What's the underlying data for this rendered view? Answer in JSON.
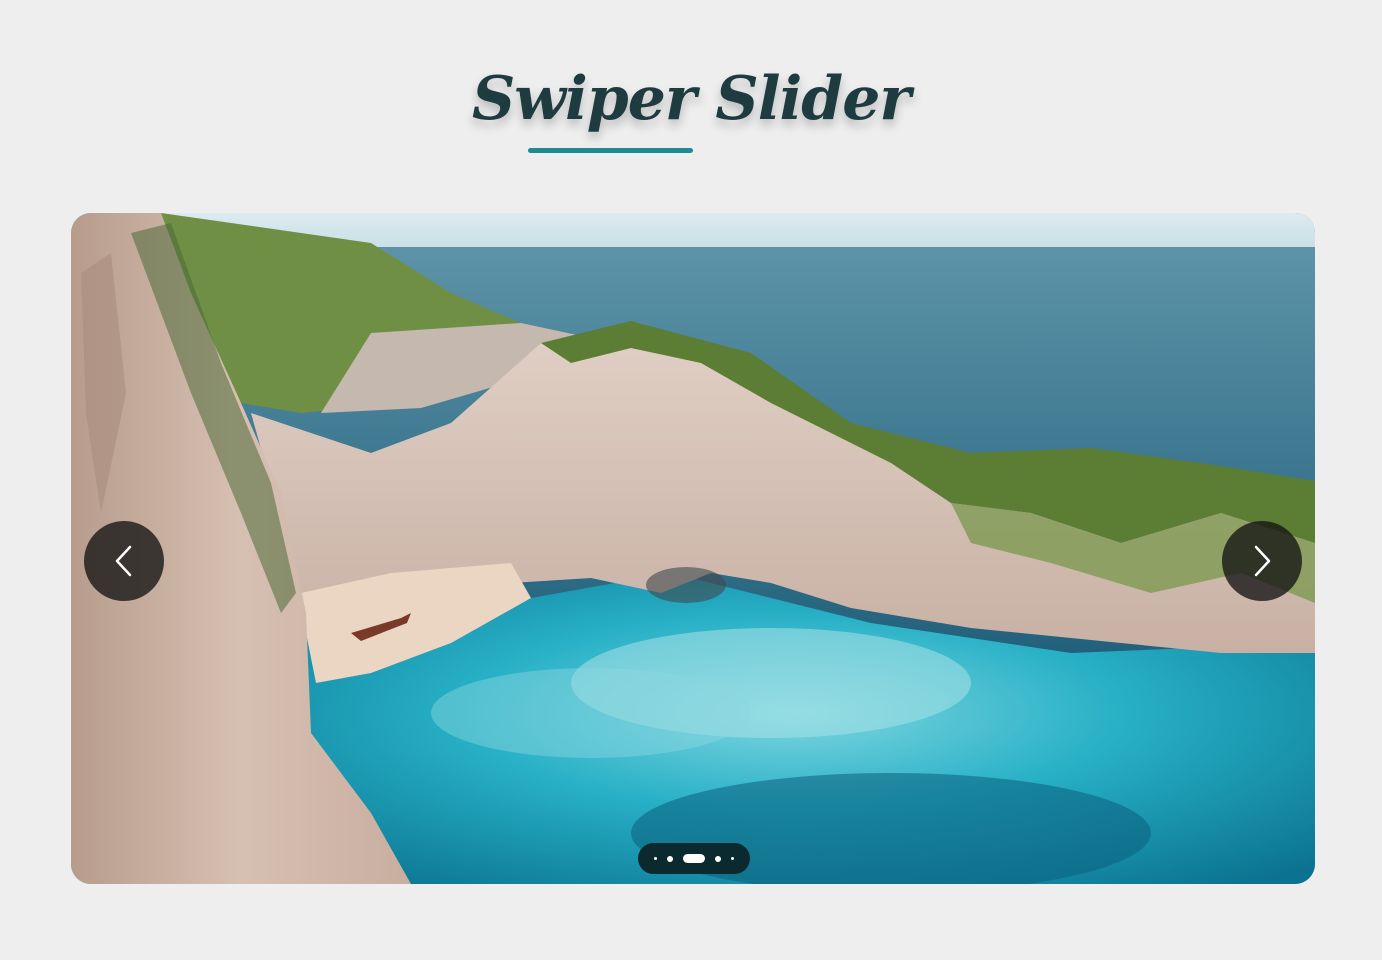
{
  "page": {
    "title": "Swiper Slider"
  },
  "slider": {
    "current_slide_icon": "coastal-cove-photo",
    "prev_icon": "chevron-left-icon",
    "next_icon": "chevron-right-icon",
    "pagination": {
      "bullet_count": 5,
      "active_index": 2
    }
  },
  "colors": {
    "background": "#eeeeee",
    "title": "#1e3b3f",
    "accent": "#1f8a91",
    "nav_button": "#141414",
    "pagination_bg": "#0a2a30"
  }
}
